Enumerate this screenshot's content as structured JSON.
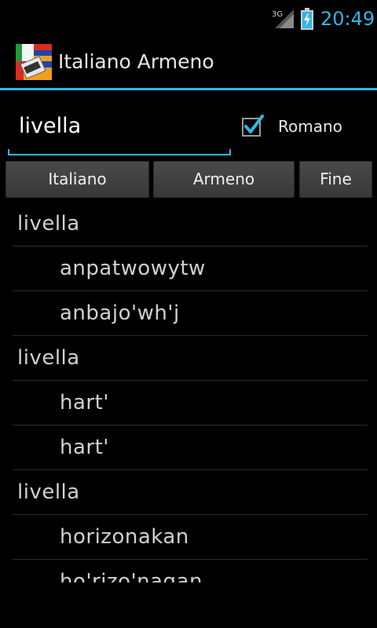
{
  "status_bar": {
    "network": "3G",
    "time": "20:49"
  },
  "action_bar": {
    "title": "Italiano Armeno",
    "icon": "italy-armenia-flag-dictionary-icon"
  },
  "search": {
    "value": "livella",
    "romano_checked": true,
    "romano_label": "Romano"
  },
  "buttons": {
    "italiano": "Italiano",
    "armeno": "Armeno",
    "fine": "Fine"
  },
  "results": [
    {
      "type": "header",
      "text": "livella"
    },
    {
      "type": "sub",
      "text": "anpatwowytw"
    },
    {
      "type": "sub",
      "text": "anbajo'wh'j"
    },
    {
      "type": "header",
      "text": "livella"
    },
    {
      "type": "sub",
      "text": "hart'"
    },
    {
      "type": "sub",
      "text": "hart'"
    },
    {
      "type": "header",
      "text": "livella"
    },
    {
      "type": "sub",
      "text": "horizonakan"
    },
    {
      "type": "sub",
      "text": "ho'rizo'nagan"
    }
  ],
  "colors": {
    "accent": "#33b5e5",
    "background": "#000000"
  }
}
